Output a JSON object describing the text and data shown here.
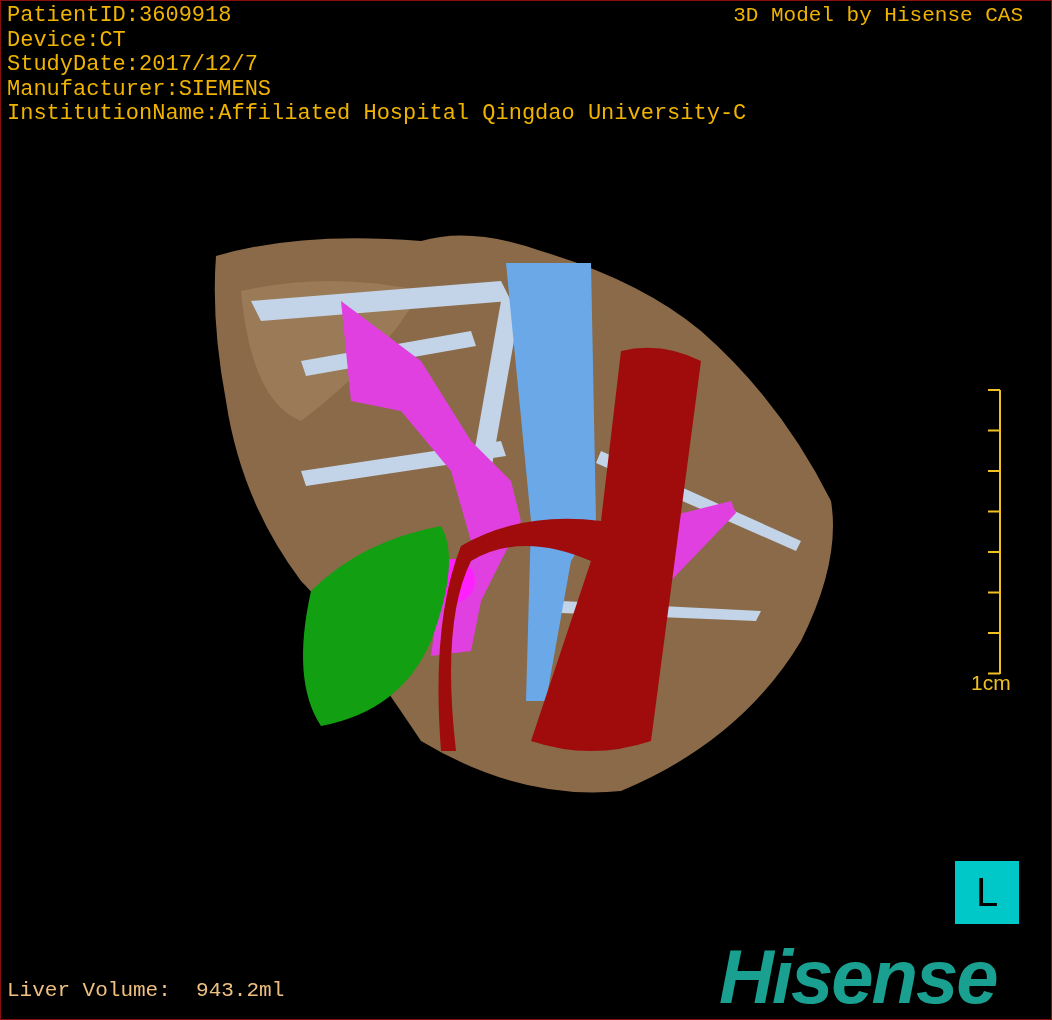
{
  "info_lines": [
    "PatientID:3609918",
    "Device:CT",
    "StudyDate:2017/12/7",
    "Manufacturer:SIEMENS",
    "InstitutionName:Affiliated Hospital Qingdao University-C"
  ],
  "title": "3D Model by Hisense CAS",
  "scale": {
    "label": "1cm"
  },
  "orientation": {
    "label": "L"
  },
  "liver_volume": "Liver Volume:  943.2ml",
  "logo": "Hisense"
}
